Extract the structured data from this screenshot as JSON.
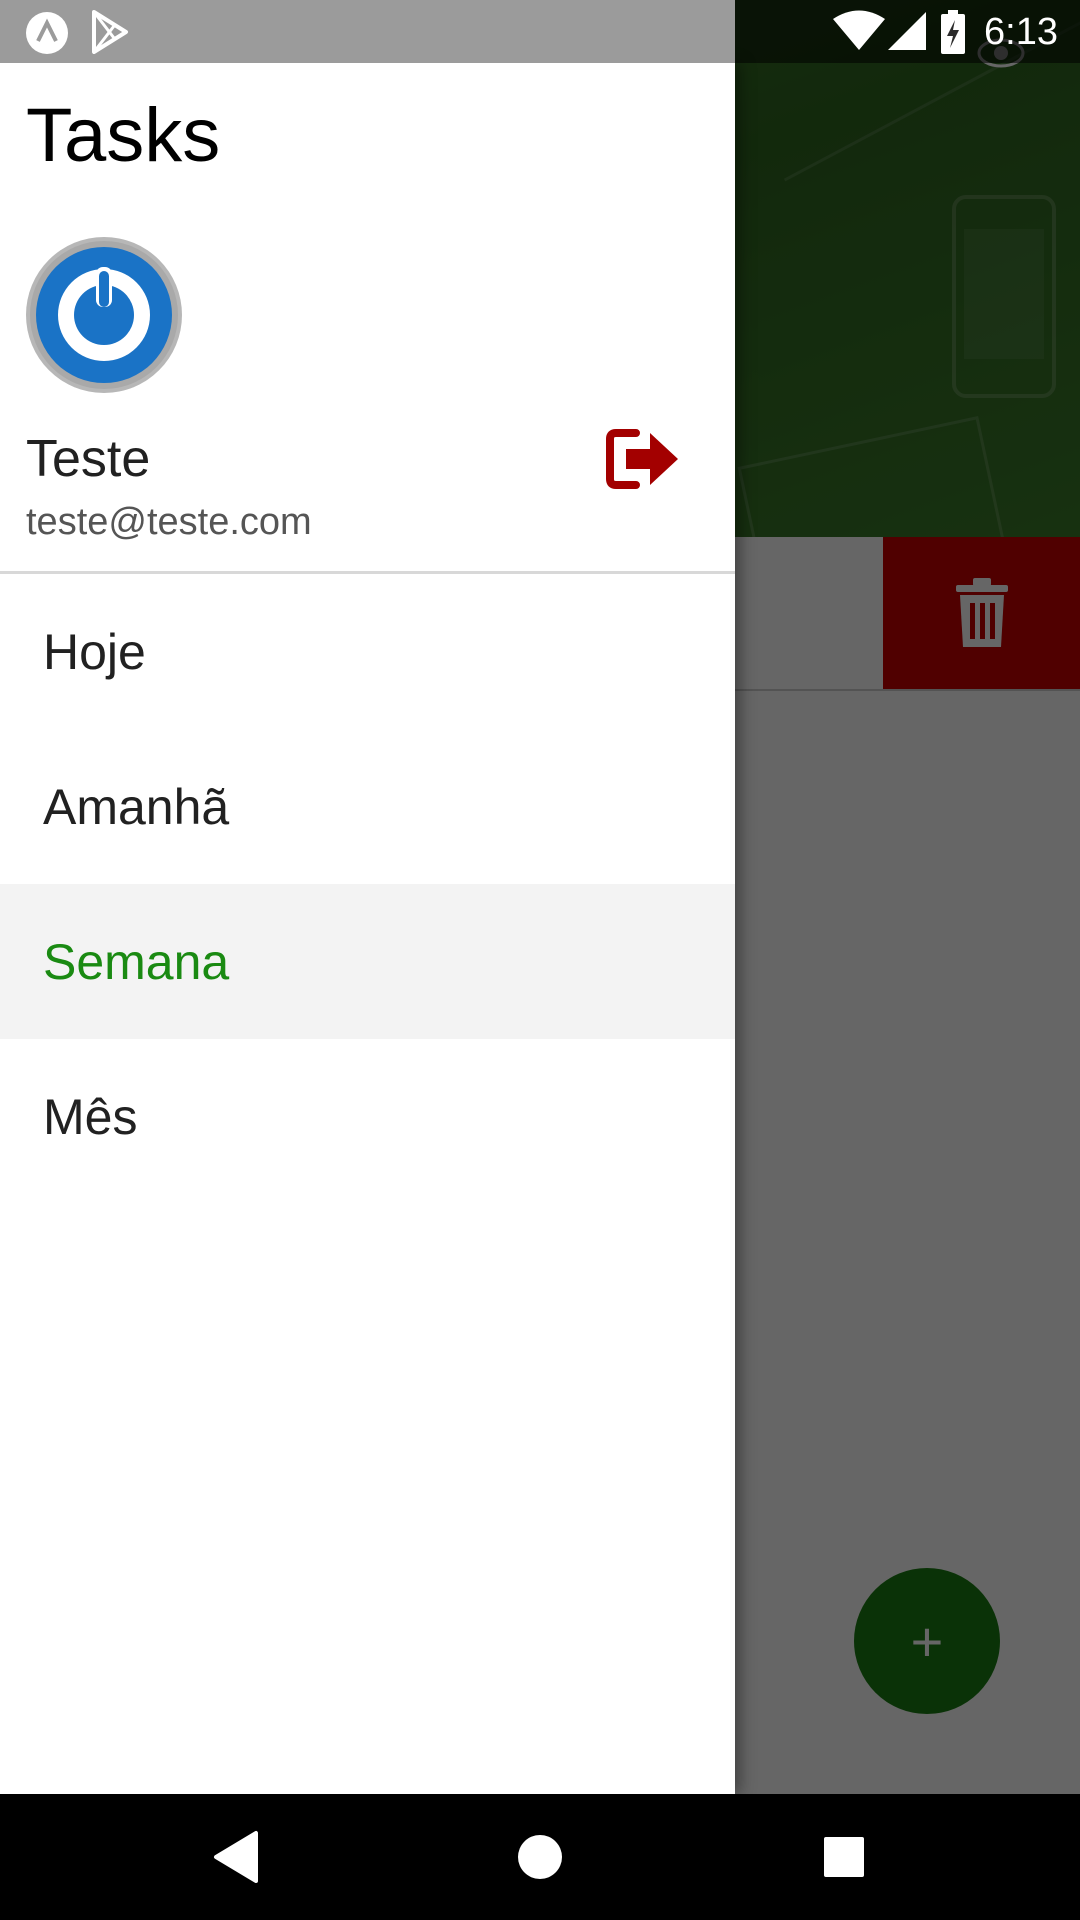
{
  "status_bar": {
    "time": "6:13",
    "left_icons": [
      "react-native-icon",
      "play-store-icon"
    ],
    "right_icons": [
      "wifi-icon",
      "signal-icon",
      "battery-charging-icon"
    ]
  },
  "drawer": {
    "title": "Tasks",
    "user": {
      "name": "Teste",
      "email": "teste@teste.com",
      "avatar_icon": "power-icon"
    },
    "logout_icon": "sign-out-icon",
    "items": [
      {
        "label": "Hoje",
        "active": false
      },
      {
        "label": "Amanhã",
        "active": false
      },
      {
        "label": "Semana",
        "active": true
      },
      {
        "label": "Mês",
        "active": false
      }
    ]
  },
  "background": {
    "hero_icon": "eye-icon",
    "delete_icon": "trash-icon",
    "fab_label": "+"
  },
  "colors": {
    "accent": "#1a8a12",
    "danger": "#c70000",
    "status_bar": "#9b9b9b",
    "drawer_bg": "#ffffff",
    "active_item_bg": "#f3f3f3"
  },
  "nav_bar": {
    "buttons": [
      "back-icon",
      "home-icon",
      "recents-icon"
    ]
  }
}
